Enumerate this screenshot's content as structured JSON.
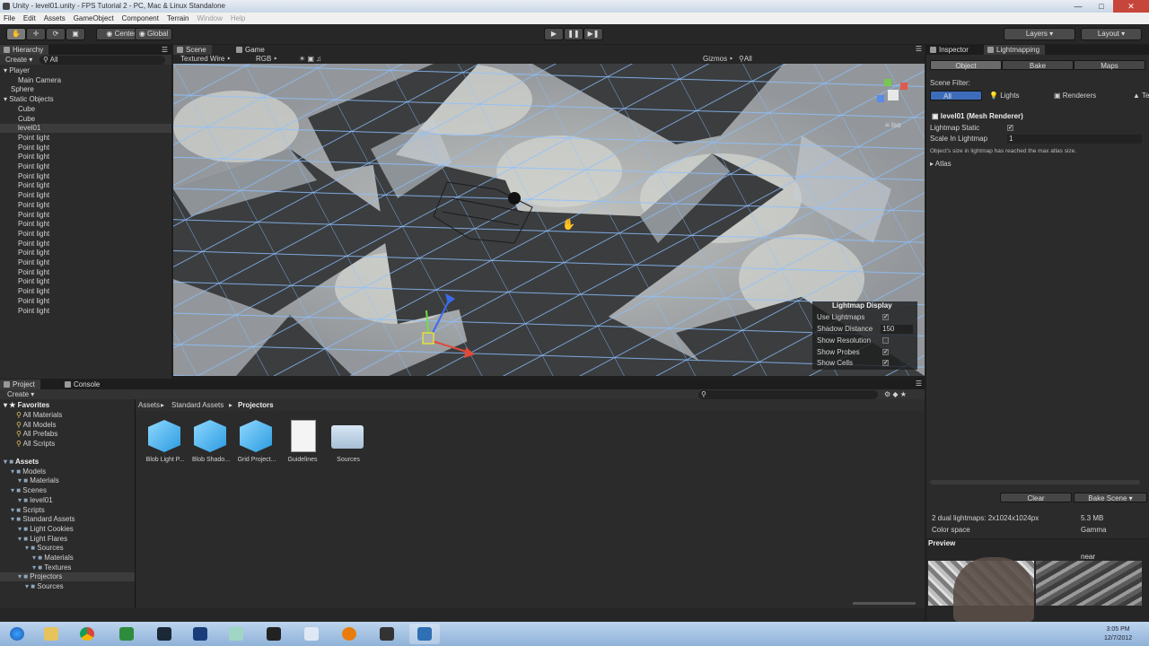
{
  "window": {
    "title": "Unity - level01.unity - FPS Tutorial 2 - PC, Mac & Linux Standalone"
  },
  "menu": [
    "File",
    "Edit",
    "Assets",
    "GameObject",
    "Component",
    "Terrain",
    "Window",
    "Help"
  ],
  "toolbar": {
    "pivot": "Center",
    "space": "Global",
    "layers": "Layers",
    "layout": "Layout"
  },
  "hierarchy": {
    "tab": "Hierarchy",
    "create": "Create",
    "search": "All",
    "items": [
      {
        "label": "Player",
        "indent": 0,
        "arrow": true
      },
      {
        "label": "Main Camera",
        "indent": 2
      },
      {
        "label": "Sphere",
        "indent": 1
      },
      {
        "label": "Static Objects",
        "indent": 0,
        "arrow": true
      },
      {
        "label": "Cube",
        "indent": 2
      },
      {
        "label": "Cube",
        "indent": 2
      },
      {
        "label": "level01",
        "indent": 2,
        "selected": true
      },
      {
        "label": "Point light",
        "indent": 2
      },
      {
        "label": "Point light",
        "indent": 2
      },
      {
        "label": "Point light",
        "indent": 2
      },
      {
        "label": "Point light",
        "indent": 2
      },
      {
        "label": "Point light",
        "indent": 2
      },
      {
        "label": "Point light",
        "indent": 2
      },
      {
        "label": "Point light",
        "indent": 2
      },
      {
        "label": "Point light",
        "indent": 2
      },
      {
        "label": "Point light",
        "indent": 2
      },
      {
        "label": "Point light",
        "indent": 2
      },
      {
        "label": "Point light",
        "indent": 2
      },
      {
        "label": "Point light",
        "indent": 2
      },
      {
        "label": "Point light",
        "indent": 2
      },
      {
        "label": "Point light",
        "indent": 2
      },
      {
        "label": "Point light",
        "indent": 2
      },
      {
        "label": "Point light",
        "indent": 2
      },
      {
        "label": "Point light",
        "indent": 2
      },
      {
        "label": "Point light",
        "indent": 2
      },
      {
        "label": "Point light",
        "indent": 2
      }
    ]
  },
  "scene": {
    "tab_scene": "Scene",
    "tab_game": "Game",
    "render_mode": "Textured Wire",
    "color_mode": "RGB",
    "gizmos": "Gizmos",
    "search": "All",
    "iso": "Iso"
  },
  "lightmap_display": {
    "title": "Lightmap Display",
    "rows": [
      {
        "label": "Use Lightmaps",
        "checked": true
      },
      {
        "label": "Shadow Distance",
        "value": "150"
      },
      {
        "label": "Show Resolution",
        "checked": false
      },
      {
        "label": "Show Probes",
        "checked": true
      },
      {
        "label": "Show Cells",
        "checked": true
      }
    ]
  },
  "inspector": {
    "tab_inspector": "Inspector",
    "tab_lightmapping": "Lightmapping",
    "subtabs": [
      "Object",
      "Bake",
      "Maps"
    ],
    "scene_filter": "Scene Filter:",
    "filters": [
      "All",
      "Lights",
      "Renderers",
      "Te"
    ],
    "object": "level01 (Mesh Renderer)",
    "lightmap_static": "Lightmap Static",
    "scale_label": "Scale In Lightmap",
    "scale_value": "1",
    "note": "Object's size in lightmap has reached the max atlas size.",
    "atlas": "Atlas",
    "clear": "Clear",
    "bake_scene": "Bake Scene",
    "lightmaps_info": "2 dual lightmaps: 2x1024x1024px",
    "size": "5.3 MB",
    "color_space_label": "Color space",
    "color_space_value": "Gamma",
    "preview": "Preview",
    "near": "near"
  },
  "project": {
    "tab_project": "Project",
    "tab_console": "Console",
    "create": "Create",
    "favorites": "Favorites",
    "fav_items": [
      "All Materials",
      "All Models",
      "All Prefabs",
      "All Scripts"
    ],
    "assets_tree": [
      {
        "label": "Assets",
        "indent": 0,
        "bold": true
      },
      {
        "label": "Models",
        "indent": 1
      },
      {
        "label": "Materials",
        "indent": 2
      },
      {
        "label": "Scenes",
        "indent": 1
      },
      {
        "label": "level01",
        "indent": 2
      },
      {
        "label": "Scripts",
        "indent": 1
      },
      {
        "label": "Standard Assets",
        "indent": 1
      },
      {
        "label": "Light Cookies",
        "indent": 2
      },
      {
        "label": "Light Flares",
        "indent": 2
      },
      {
        "label": "Sources",
        "indent": 3
      },
      {
        "label": "Materials",
        "indent": 4
      },
      {
        "label": "Textures",
        "indent": 4
      },
      {
        "label": "Projectors",
        "indent": 2,
        "selected": true
      },
      {
        "label": "Sources",
        "indent": 3
      }
    ],
    "breadcrumb": [
      "Assets",
      "Standard Assets",
      "Projectors"
    ],
    "files": [
      {
        "label": "Blob Light P...",
        "kind": "prefab"
      },
      {
        "label": "Blob Shado...",
        "kind": "prefab"
      },
      {
        "label": "Grid Project...",
        "kind": "prefab"
      },
      {
        "label": "Guidelines",
        "kind": "doc"
      },
      {
        "label": "Sources",
        "kind": "folder"
      }
    ]
  },
  "taskbar": {
    "time": "3:05 PM",
    "date": "12/7/2012"
  },
  "colors": {
    "accent": "#3d6dba",
    "panel": "#2b2b2b",
    "dark": "#1d1d1d"
  }
}
